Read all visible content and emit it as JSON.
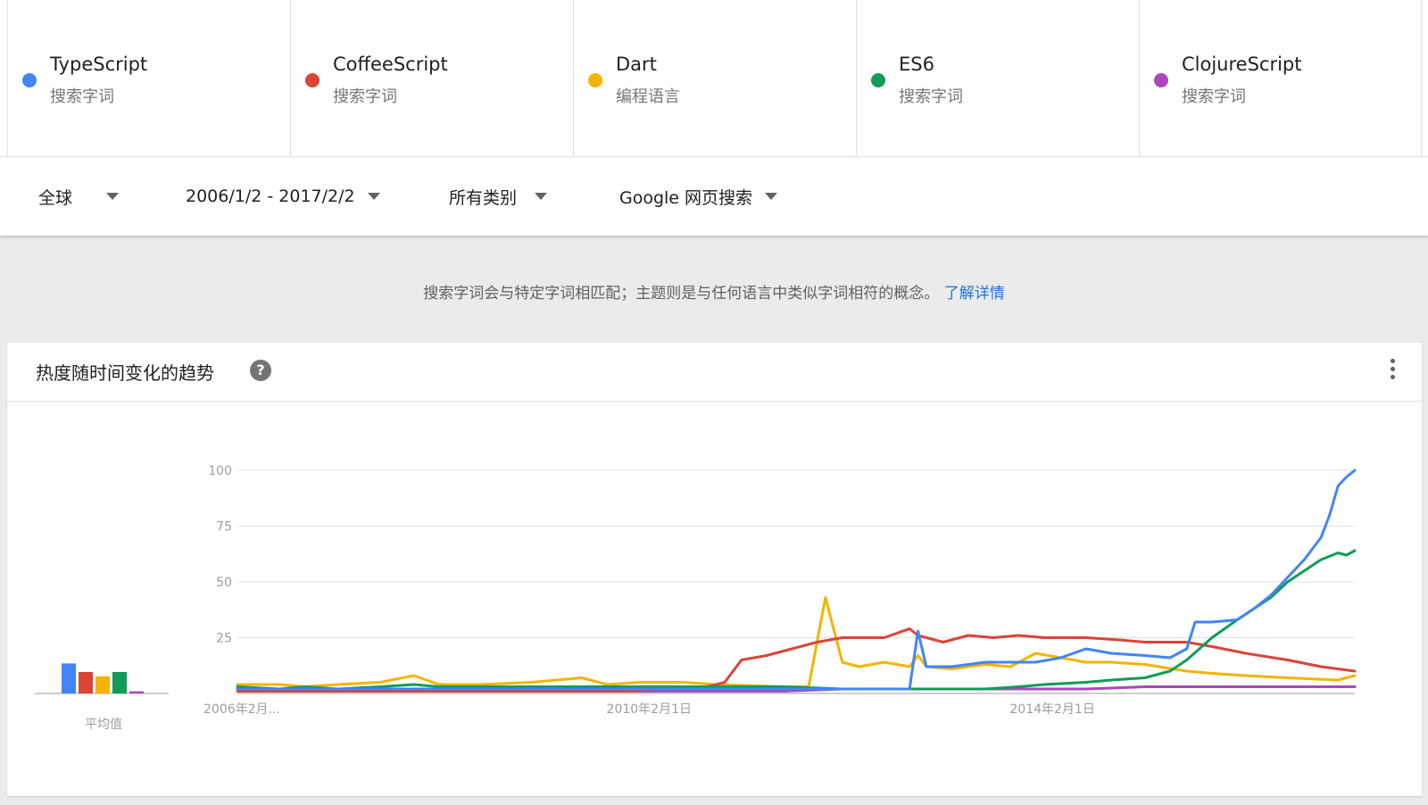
{
  "terms": [
    {
      "name": "TypeScript",
      "type": "搜索字词",
      "color": "#4285f4"
    },
    {
      "name": "CoffeeScript",
      "type": "搜索字词",
      "color": "#db4437"
    },
    {
      "name": "Dart",
      "type": "编程语言",
      "color": "#f4b400"
    },
    {
      "name": "ES6",
      "type": "搜索字词",
      "color": "#0f9d58"
    },
    {
      "name": "ClojureScript",
      "type": "搜索字词",
      "color": "#ab47bc"
    }
  ],
  "filters": {
    "region": "全球",
    "date_range": "2006/1/2 - 2017/2/2",
    "category": "所有类别",
    "search_type": "Google 网页搜索"
  },
  "info": {
    "text": "搜索字词会与特定字词相匹配；主题则是与任何语言中类似字词相符的概念。",
    "link": "了解详情"
  },
  "panel": {
    "title": "热度随时间变化的趋势",
    "help_icon": "help-circle-icon",
    "more_icon": "more-vert-icon",
    "average_label": "平均值"
  },
  "chart_data": {
    "type": "line",
    "title": "热度随时间变化的趋势",
    "x_tick_labels": [
      "2006年2月...",
      "2010年2月1日",
      "2014年2月1日"
    ],
    "x_range": [
      "2006-01",
      "2017-02"
    ],
    "ylim": [
      0,
      100
    ],
    "y_ticks": [
      25,
      50,
      75,
      100
    ],
    "grid": true,
    "average_bars": [
      {
        "name": "TypeScript",
        "value": 14
      },
      {
        "name": "CoffeeScript",
        "value": 10
      },
      {
        "name": "Dart",
        "value": 8
      },
      {
        "name": "ES6",
        "value": 10
      },
      {
        "name": "ClojureScript",
        "value": 1
      }
    ],
    "series": [
      {
        "name": "TypeScript",
        "color": "#4285f4",
        "points": [
          [
            "2006-01",
            2
          ],
          [
            "2010-01",
            2
          ],
          [
            "2012-06",
            2
          ],
          [
            "2012-09",
            2
          ],
          [
            "2012-10",
            28
          ],
          [
            "2012-11",
            12
          ],
          [
            "2013-02",
            12
          ],
          [
            "2013-06",
            14
          ],
          [
            "2013-09",
            14
          ],
          [
            "2013-12",
            14
          ],
          [
            "2014-03",
            16
          ],
          [
            "2014-06",
            20
          ],
          [
            "2014-09",
            18
          ],
          [
            "2015-01",
            17
          ],
          [
            "2015-04",
            16
          ],
          [
            "2015-06",
            20
          ],
          [
            "2015-07",
            32
          ],
          [
            "2015-09",
            32
          ],
          [
            "2015-12",
            33
          ],
          [
            "2016-02",
            38
          ],
          [
            "2016-04",
            44
          ],
          [
            "2016-06",
            52
          ],
          [
            "2016-08",
            60
          ],
          [
            "2016-10",
            70
          ],
          [
            "2016-11",
            80
          ],
          [
            "2016-12",
            93
          ],
          [
            "2017-01",
            97
          ],
          [
            "2017-02",
            100
          ]
        ]
      },
      {
        "name": "CoffeeScript",
        "color": "#db4437",
        "points": [
          [
            "2006-01",
            1
          ],
          [
            "2009-12",
            1
          ],
          [
            "2010-03",
            2
          ],
          [
            "2010-09",
            3
          ],
          [
            "2010-11",
            5
          ],
          [
            "2011-01",
            15
          ],
          [
            "2011-04",
            17
          ],
          [
            "2011-07",
            20
          ],
          [
            "2011-10",
            23
          ],
          [
            "2012-01",
            25
          ],
          [
            "2012-06",
            25
          ],
          [
            "2012-09",
            29
          ],
          [
            "2012-10",
            26
          ],
          [
            "2013-01",
            23
          ],
          [
            "2013-04",
            26
          ],
          [
            "2013-07",
            25
          ],
          [
            "2013-10",
            26
          ],
          [
            "2014-01",
            25
          ],
          [
            "2014-06",
            25
          ],
          [
            "2014-10",
            24
          ],
          [
            "2015-01",
            23
          ],
          [
            "2015-06",
            23
          ],
          [
            "2015-09",
            21
          ],
          [
            "2016-01",
            18
          ],
          [
            "2016-06",
            15
          ],
          [
            "2016-10",
            12
          ],
          [
            "2017-02",
            10
          ]
        ]
      },
      {
        "name": "Dart",
        "color": "#f4b400",
        "points": [
          [
            "2006-01",
            4
          ],
          [
            "2006-06",
            4
          ],
          [
            "2006-09",
            3
          ],
          [
            "2007-01",
            4
          ],
          [
            "2007-06",
            5
          ],
          [
            "2007-10",
            8
          ],
          [
            "2008-01",
            4
          ],
          [
            "2008-06",
            4
          ],
          [
            "2008-12",
            5
          ],
          [
            "2009-03",
            6
          ],
          [
            "2009-06",
            7
          ],
          [
            "2009-09",
            4
          ],
          [
            "2010-01",
            5
          ],
          [
            "2010-06",
            5
          ],
          [
            "2010-10",
            4
          ],
          [
            "2011-06",
            3
          ],
          [
            "2011-09",
            3
          ],
          [
            "2011-11",
            43
          ],
          [
            "2012-01",
            14
          ],
          [
            "2012-03",
            12
          ],
          [
            "2012-06",
            14
          ],
          [
            "2012-09",
            12
          ],
          [
            "2012-10",
            17
          ],
          [
            "2012-11",
            12
          ],
          [
            "2013-02",
            11
          ],
          [
            "2013-06",
            13
          ],
          [
            "2013-09",
            12
          ],
          [
            "2013-12",
            18
          ],
          [
            "2014-03",
            16
          ],
          [
            "2014-06",
            14
          ],
          [
            "2014-09",
            14
          ],
          [
            "2015-01",
            13
          ],
          [
            "2015-06",
            10
          ],
          [
            "2015-09",
            9
          ],
          [
            "2016-01",
            8
          ],
          [
            "2016-06",
            7
          ],
          [
            "2016-12",
            6
          ],
          [
            "2017-02",
            8
          ]
        ]
      },
      {
        "name": "ES6",
        "color": "#0f9d58",
        "points": [
          [
            "2006-01",
            3
          ],
          [
            "2006-06",
            2
          ],
          [
            "2006-09",
            3
          ],
          [
            "2007-01",
            2
          ],
          [
            "2007-06",
            3
          ],
          [
            "2007-10",
            4
          ],
          [
            "2008-01",
            3
          ],
          [
            "2008-06",
            3
          ],
          [
            "2009-01",
            3
          ],
          [
            "2009-06",
            3
          ],
          [
            "2010-01",
            3
          ],
          [
            "2011-01",
            3
          ],
          [
            "2011-06",
            3
          ],
          [
            "2012-01",
            2
          ],
          [
            "2012-06",
            2
          ],
          [
            "2012-09",
            2
          ],
          [
            "2013-01",
            2
          ],
          [
            "2013-06",
            2
          ],
          [
            "2013-10",
            3
          ],
          [
            "2014-01",
            4
          ],
          [
            "2014-06",
            5
          ],
          [
            "2014-09",
            6
          ],
          [
            "2015-01",
            7
          ],
          [
            "2015-04",
            10
          ],
          [
            "2015-06",
            15
          ],
          [
            "2015-09",
            25
          ],
          [
            "2015-12",
            33
          ],
          [
            "2016-02",
            38
          ],
          [
            "2016-04",
            43
          ],
          [
            "2016-06",
            50
          ],
          [
            "2016-08",
            55
          ],
          [
            "2016-10",
            60
          ],
          [
            "2016-12",
            63
          ],
          [
            "2017-01",
            62
          ],
          [
            "2017-02",
            64
          ]
        ]
      },
      {
        "name": "ClojureScript",
        "color": "#ab47bc",
        "points": [
          [
            "2006-01",
            1
          ],
          [
            "2010-01",
            1
          ],
          [
            "2011-06",
            1
          ],
          [
            "2012-01",
            2
          ],
          [
            "2012-06",
            2
          ],
          [
            "2013-01",
            2
          ],
          [
            "2013-06",
            2
          ],
          [
            "2014-01",
            2
          ],
          [
            "2014-06",
            2
          ],
          [
            "2015-01",
            3
          ],
          [
            "2015-06",
            3
          ],
          [
            "2015-10",
            3
          ],
          [
            "2016-01",
            3
          ],
          [
            "2016-06",
            3
          ],
          [
            "2017-02",
            3
          ]
        ]
      }
    ]
  }
}
